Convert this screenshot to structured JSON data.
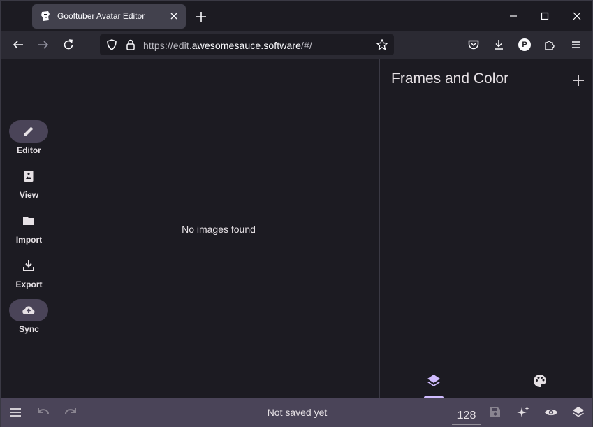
{
  "browser": {
    "tab_title": "Gooftuber Avatar Editor",
    "url_prefix": "https://edit.",
    "url_domain": "awesomesauce.software",
    "url_suffix": "/#/",
    "profile_initial": "P"
  },
  "rail": {
    "items": [
      {
        "label": "Editor",
        "icon": "pencil-icon",
        "active": true
      },
      {
        "label": "View",
        "icon": "portrait-icon",
        "active": false
      },
      {
        "label": "Import",
        "icon": "folder-icon",
        "active": false
      },
      {
        "label": "Export",
        "icon": "download-icon",
        "active": false
      },
      {
        "label": "Sync",
        "icon": "cloud-upload-icon",
        "active": true
      }
    ]
  },
  "canvas": {
    "empty_message": "No images found"
  },
  "panel": {
    "title": "Frames and Color",
    "tabs": [
      {
        "icon": "layers-icon",
        "active": true
      },
      {
        "icon": "palette-icon",
        "active": false
      }
    ]
  },
  "bottombar": {
    "status": "Not saved yet",
    "size_value": "128"
  },
  "colors": {
    "accent": "#d0bcff",
    "bar": "#4a4458",
    "background": "#1c1b22"
  }
}
